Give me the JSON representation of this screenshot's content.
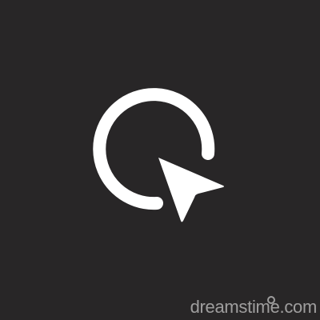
{
  "canvas": {
    "background_color": "#282627"
  },
  "icon": {
    "name": "cursor-click-icon",
    "color": "#ffffff"
  },
  "watermark": {
    "text_part1": "dreams",
    "text_part2": "time",
    "text_part3": ".com"
  }
}
